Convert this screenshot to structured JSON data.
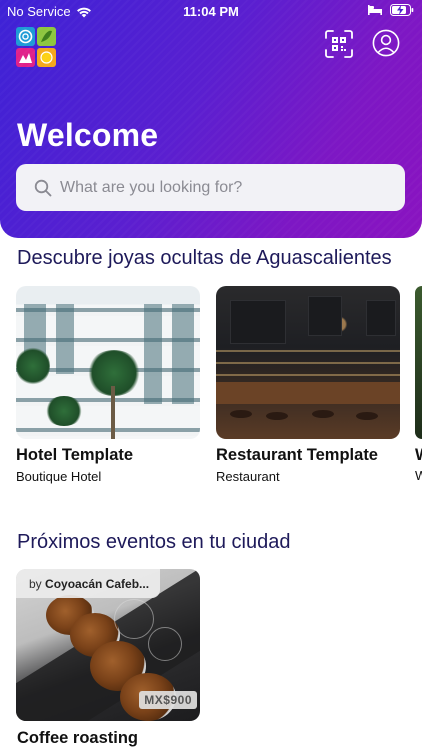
{
  "status_bar": {
    "carrier": "No Service",
    "time": "11:04 PM"
  },
  "header": {
    "logo_icon": "city-guide-logo",
    "qr_icon": "qr-scan-icon",
    "profile_icon": "user-profile-icon",
    "title": "Welcome"
  },
  "search": {
    "placeholder": "What are you looking for?"
  },
  "sections": {
    "places_title": "Descubre joyas ocultas de Aguascalientes",
    "events_title": "Próximos eventos en tu ciudad"
  },
  "places": [
    {
      "name": "Hotel Template",
      "category": "Boutique Hotel"
    },
    {
      "name": "Restaurant Template",
      "category": "Restaurant"
    },
    {
      "name": "W",
      "category": "W"
    }
  ],
  "events": [
    {
      "organizer_prefix": "by",
      "organizer": "Coyoacán Cafeb...",
      "price": "MX$900",
      "name": "Coffee roasting"
    }
  ],
  "colors": {
    "gradient_start": "#3d22d6",
    "gradient_end": "#8a13c0",
    "section_title": "#1e1a5a"
  }
}
